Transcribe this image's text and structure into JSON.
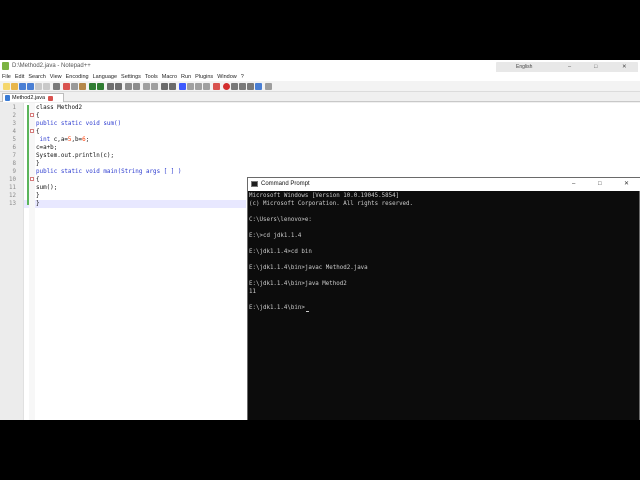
{
  "notepad": {
    "title": "D:\\Method2.java - Notepad++",
    "menu": [
      "File",
      "Edit",
      "Search",
      "View",
      "Encoding",
      "Language",
      "Settings",
      "Tools",
      "Macro",
      "Run",
      "Plugins",
      "Window",
      "?"
    ],
    "language_indicator": "English",
    "window_controls": [
      "–",
      "□",
      "✕"
    ],
    "tab_label": "Method2.java",
    "line_numbers": [
      "1",
      "2",
      "3",
      "4",
      "5",
      "6",
      "7",
      "8",
      "9",
      "10",
      "11",
      "12",
      "13"
    ],
    "code_lines": [
      "class Method2",
      "{",
      "public static void sum()",
      "{",
      " int c,a=5,b=6;",
      "c=a+b;",
      "System.out.println(c);",
      "}",
      "public static void main(String args [ ] )",
      "{",
      "sum();",
      "}",
      "}"
    ]
  },
  "cmd": {
    "title": "Command Prompt",
    "window_controls": [
      "–",
      "□",
      "✕"
    ],
    "lines": [
      "Microsoft Windows [Version 10.0.19045.5854]",
      "(c) Microsoft Corporation. All rights reserved.",
      "",
      "C:\\Users\\lenovo>e:",
      "",
      "E:\\>cd jdk1.1.4",
      "",
      "E:\\jdk1.1.4>cd bin",
      "",
      "E:\\jdk1.1.4\\bin>javac Method2.java",
      "",
      "E:\\jdk1.1.4\\bin>java Method2",
      "11",
      "",
      "E:\\jdk1.1.4\\bin>"
    ]
  },
  "colors": {
    "keyword": "#2b3acf",
    "number": "#ff3a00",
    "console_bg": "#0c0c0c",
    "console_text": "#cccccc"
  }
}
